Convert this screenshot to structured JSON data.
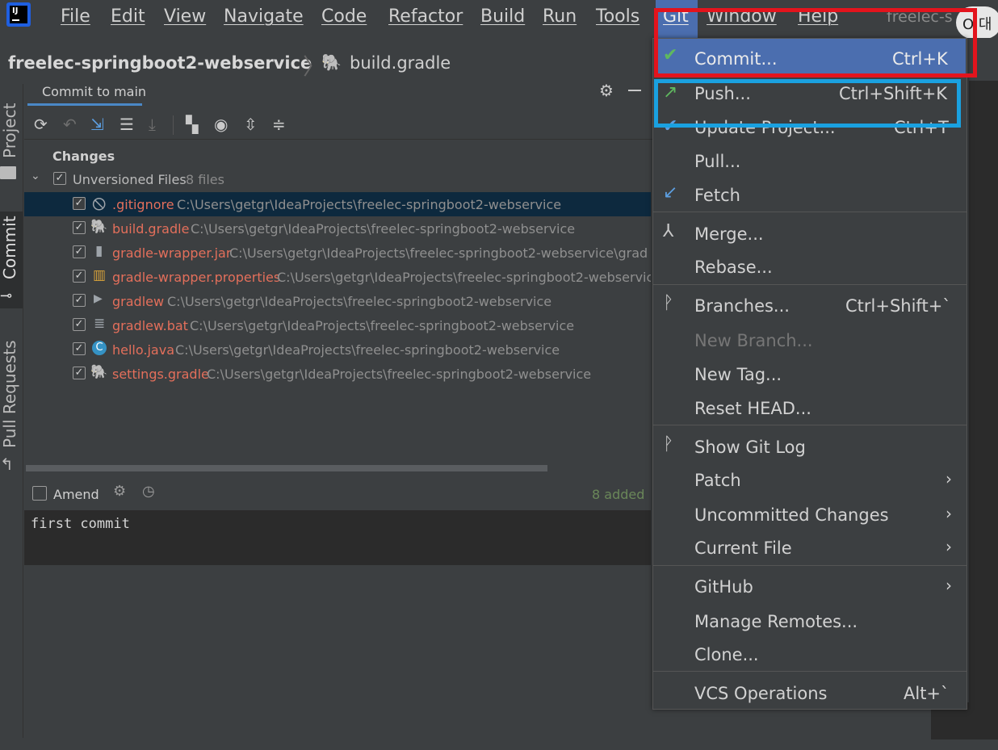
{
  "menubar": {
    "logo_text": "IJ",
    "items": [
      {
        "label": "File"
      },
      {
        "label": "Edit"
      },
      {
        "label": "View"
      },
      {
        "label": "Navigate"
      },
      {
        "label": "Code"
      },
      {
        "label": "Refactor"
      },
      {
        "label": "Build"
      },
      {
        "label": "Run"
      },
      {
        "label": "Tools"
      },
      {
        "label": "Git"
      },
      {
        "label": "Window"
      },
      {
        "label": "Help"
      }
    ],
    "project_title": "freelec-s",
    "ime_badge": "O 대"
  },
  "breadcrumb": {
    "project": "freelec-springboot2-webservice",
    "file": "build.gradle"
  },
  "left_tabs": {
    "project": "Project",
    "commit": "Commit",
    "pull_requests": "Pull Requests"
  },
  "commit_panel": {
    "tab_label": "Commit to main",
    "changes_label": "Changes",
    "group_label": "Unversioned Files",
    "group_count": "8 files",
    "files": [
      {
        "name": ".gitignore",
        "path": "C:\\Users\\getgr\\IdeaProjects\\freelec-springboot2-webservice",
        "icon": "gitignore-icon",
        "glyph": "🛇"
      },
      {
        "name": "build.gradle",
        "path": "C:\\Users\\getgr\\IdeaProjects\\freelec-springboot2-webservice",
        "icon": "gradle-icon",
        "glyph": "🐘"
      },
      {
        "name": "gradle-wrapper.jar",
        "path": "C:\\Users\\getgr\\IdeaProjects\\freelec-springboot2-webservice\\grad",
        "icon": "jar-icon",
        "glyph": "▮"
      },
      {
        "name": "gradle-wrapper.properties",
        "path": "C:\\Users\\getgr\\IdeaProjects\\freelec-springboot2-webservic",
        "icon": "properties-icon",
        "glyph": "▥"
      },
      {
        "name": "gradlew",
        "path": "C:\\Users\\getgr\\IdeaProjects\\freelec-springboot2-webservice",
        "icon": "shell-script-icon",
        "glyph": "▶"
      },
      {
        "name": "gradlew.bat",
        "path": "C:\\Users\\getgr\\IdeaProjects\\freelec-springboot2-webservice",
        "icon": "text-file-icon",
        "glyph": "≣"
      },
      {
        "name": "hello.java",
        "path": "C:\\Users\\getgr\\IdeaProjects\\freelec-springboot2-webservice",
        "icon": "java-class-icon",
        "glyph": "C"
      },
      {
        "name": "settings.gradle",
        "path": "C:\\Users\\getgr\\IdeaProjects\\freelec-springboot2-webservice",
        "icon": "gradle-icon",
        "glyph": "🐘"
      }
    ],
    "amend_label": "Amend",
    "added_status": "8 added",
    "commit_message": "first commit"
  },
  "git_menu": {
    "items": [
      {
        "label": "Commit...",
        "shortcut": "Ctrl+K",
        "icon": "check-icon"
      },
      {
        "label": "Push...",
        "shortcut": "Ctrl+Shift+K",
        "icon": "push-arrow-icon"
      },
      {
        "label": "Update Project...",
        "shortcut": "Ctrl+T",
        "icon": "update-icon"
      },
      {
        "label": "Pull...",
        "shortcut": ""
      },
      {
        "label": "Fetch",
        "shortcut": "",
        "icon": "fetch-icon"
      },
      {
        "label": "Merge...",
        "shortcut": "",
        "icon": "merge-icon"
      },
      {
        "label": "Rebase...",
        "shortcut": ""
      },
      {
        "label": "Branches...",
        "shortcut": "Ctrl+Shift+`",
        "icon": "branch-icon"
      },
      {
        "label": "New Branch...",
        "shortcut": ""
      },
      {
        "label": "New Tag...",
        "shortcut": ""
      },
      {
        "label": "Reset HEAD...",
        "shortcut": ""
      },
      {
        "label": "Show Git Log",
        "shortcut": "",
        "icon": "git-log-icon"
      },
      {
        "label": "Patch",
        "shortcut": ""
      },
      {
        "label": "Uncommitted Changes",
        "shortcut": ""
      },
      {
        "label": "Current File",
        "shortcut": ""
      },
      {
        "label": "GitHub",
        "shortcut": ""
      },
      {
        "label": "Manage Remotes...",
        "shortcut": ""
      },
      {
        "label": "Clone...",
        "shortcut": ""
      },
      {
        "label": "VCS Operations",
        "shortcut": "Alt+`"
      }
    ]
  },
  "colors": {
    "accent": "#4b6eaf",
    "annotation_red": "#e3141d",
    "annotation_blue": "#1aa1e0",
    "unversioned_file": "#e36f5b",
    "added_status": "#6a8759"
  }
}
